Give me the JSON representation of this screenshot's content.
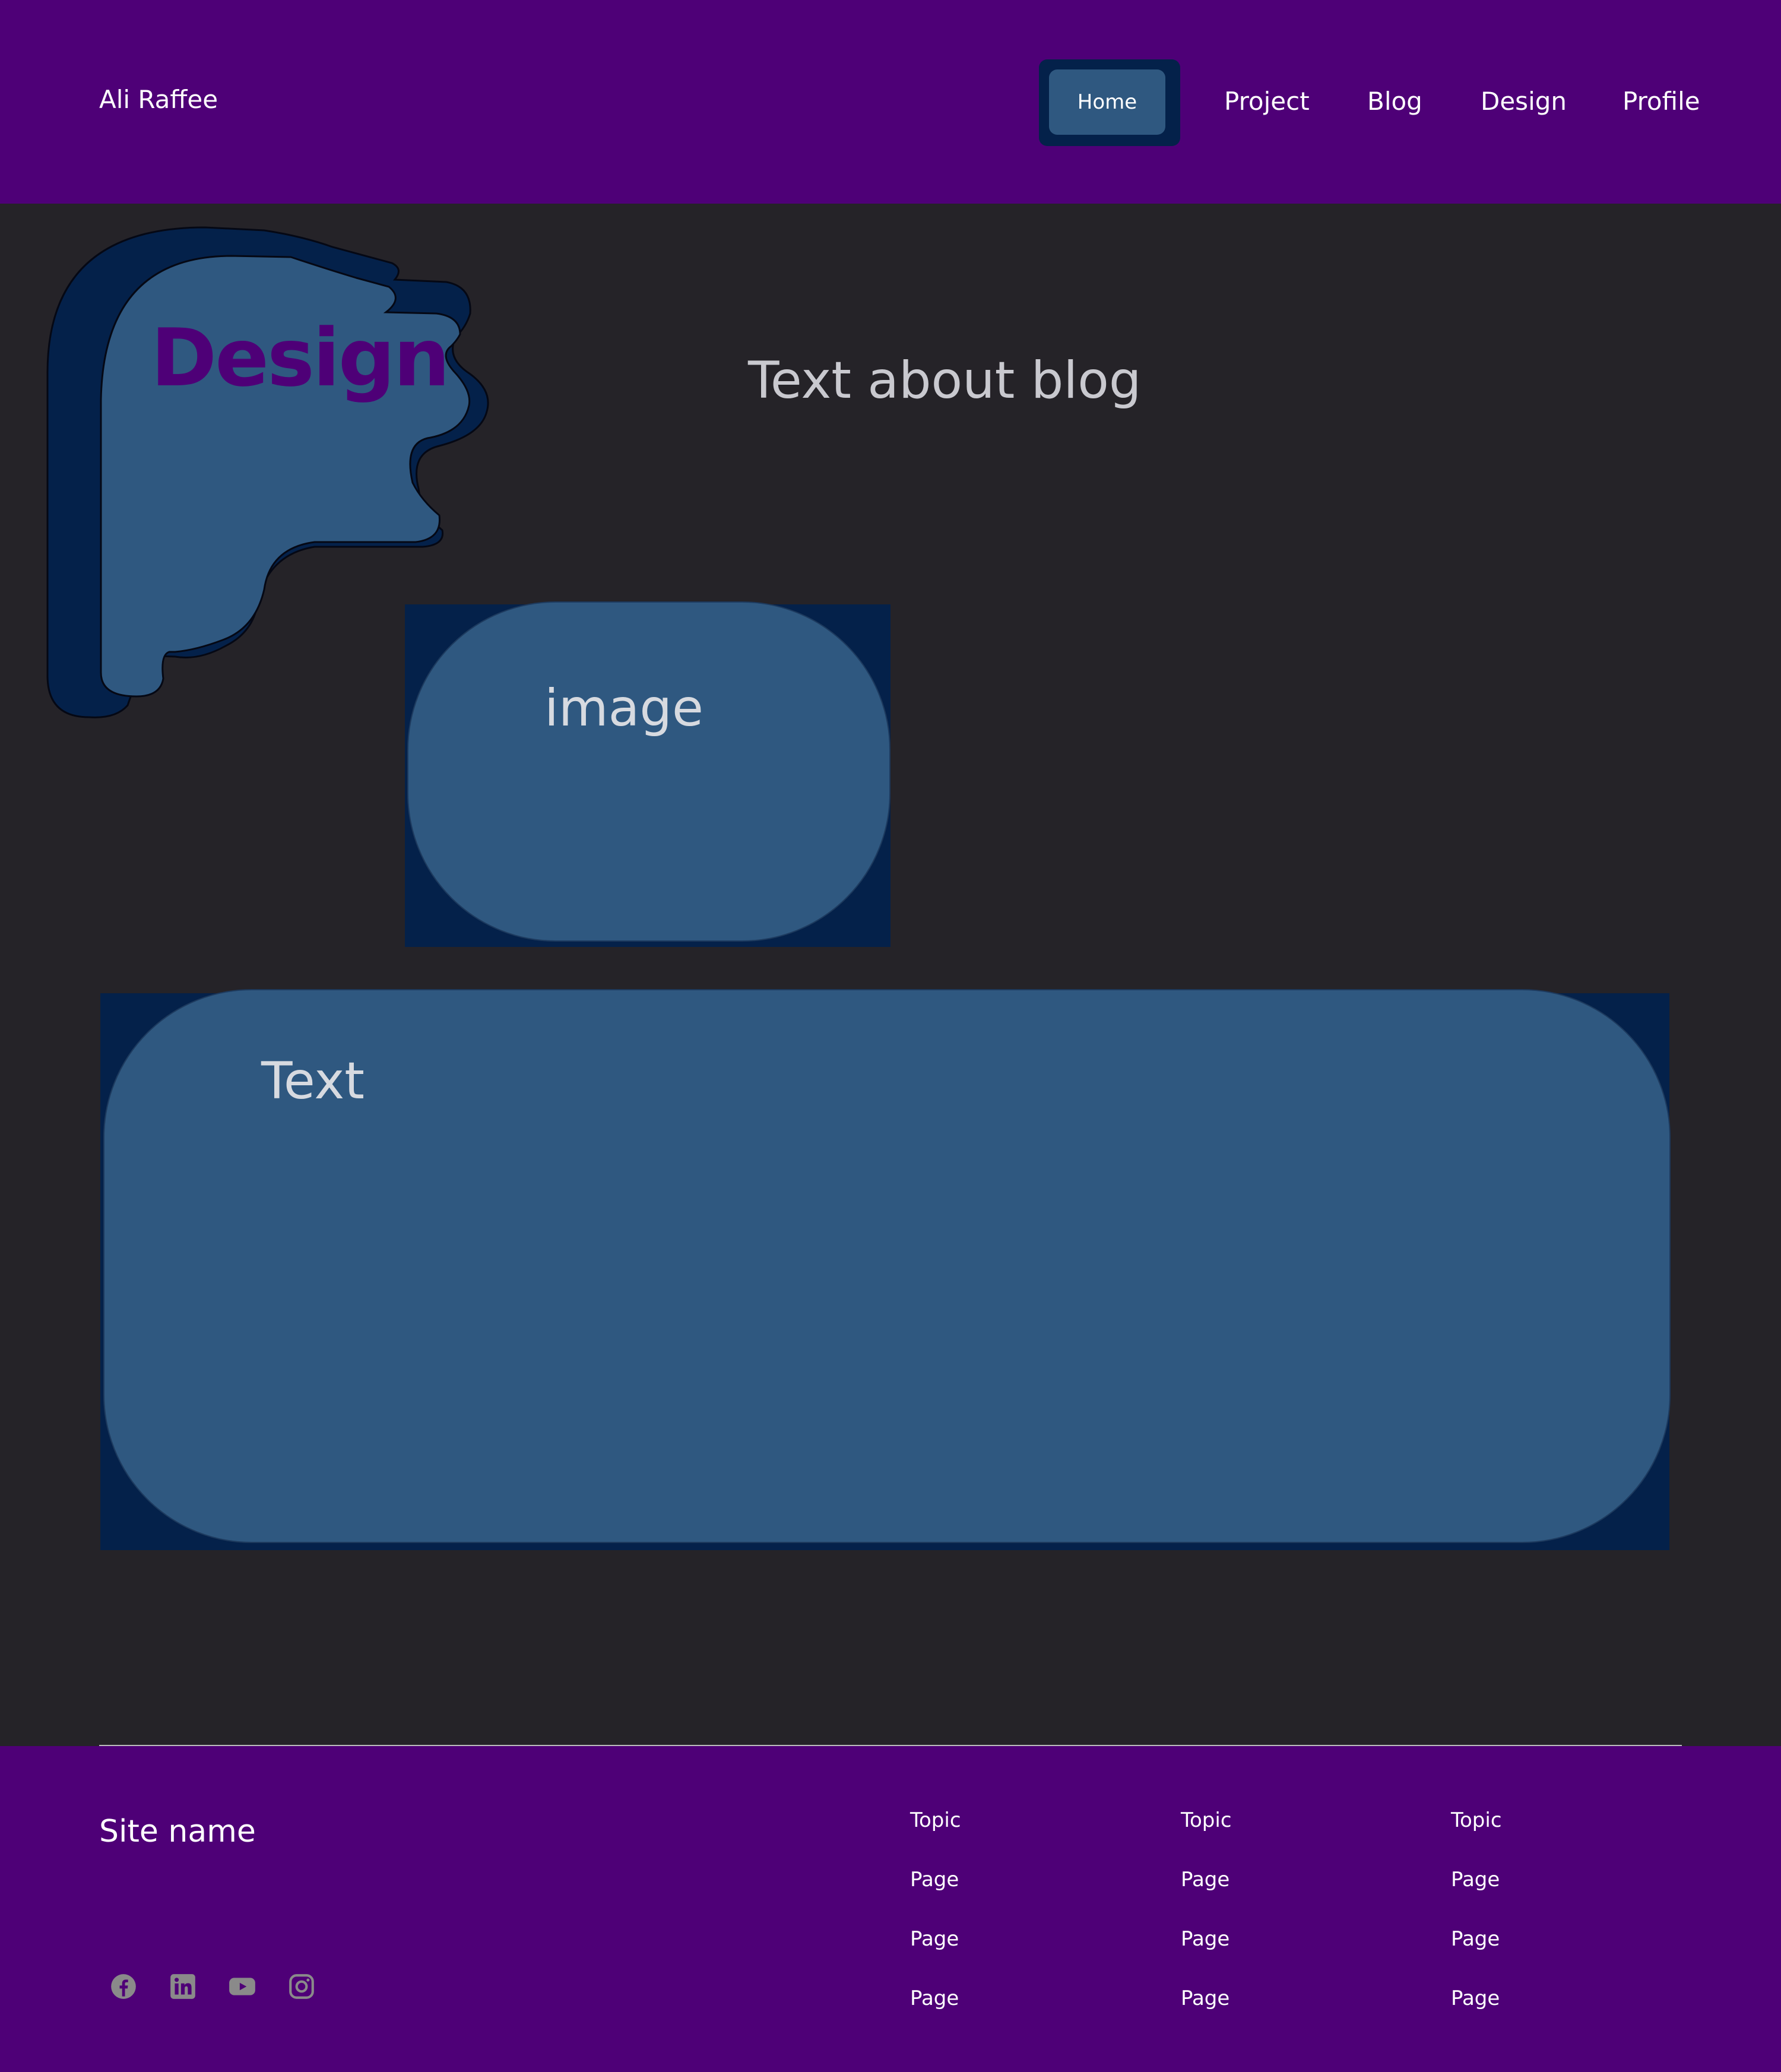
{
  "header": {
    "brand": "Ali Raffee",
    "nav": [
      {
        "label": "Home",
        "active": true
      },
      {
        "label": "Project"
      },
      {
        "label": "Blog"
      },
      {
        "label": "Design"
      },
      {
        "label": "Profile"
      }
    ]
  },
  "main": {
    "design_title": "Design",
    "blog_text": "Text about blog",
    "image_label": "image",
    "text_label": "Text"
  },
  "footer": {
    "site_name": "Site name",
    "columns": [
      {
        "topic": "Topic",
        "pages": [
          "Page",
          "Page",
          "Page"
        ]
      },
      {
        "topic": "Topic",
        "pages": [
          "Page",
          "Page",
          "Page"
        ]
      },
      {
        "topic": "Topic",
        "pages": [
          "Page",
          "Page",
          "Page"
        ]
      }
    ],
    "social_icons": [
      "facebook-icon",
      "linkedin-icon",
      "youtube-icon",
      "instagram-icon"
    ]
  },
  "colors": {
    "header_bg": "#4e0077",
    "page_bg": "#252328",
    "card_fill": "#2f5880",
    "card_shadow": "#04214a",
    "title_color": "#4e0077",
    "social_icon": "#8a8a8a"
  }
}
